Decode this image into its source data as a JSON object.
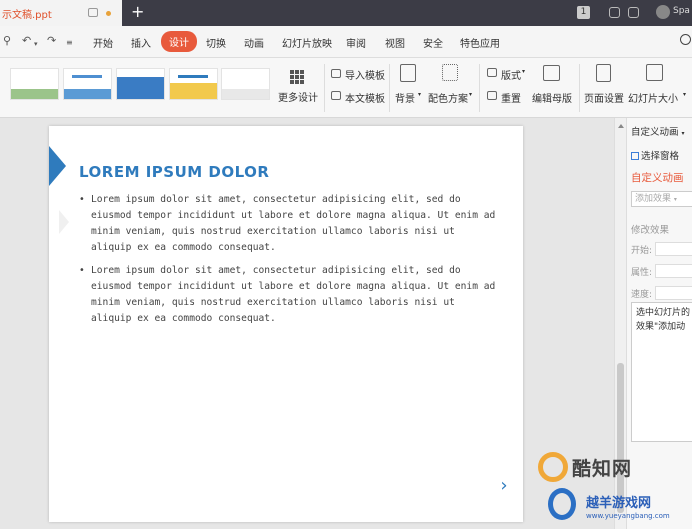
{
  "titlebar": {
    "doc_name": "示文稿.ppt",
    "user": "Spa",
    "badge": "1"
  },
  "menubar": {
    "tabs": [
      "开始",
      "插入",
      "设计",
      "切换",
      "动画",
      "幻灯片放映",
      "审阅",
      "视图",
      "安全",
      "特色应用"
    ],
    "active_tab": "设计"
  },
  "ribbon": {
    "more_designs": "更多设计",
    "import_template": "导入模板",
    "this_doc_template": "本文模板",
    "background": "背景",
    "color_scheme": "配色方案",
    "layout": "版式",
    "reset": "重置",
    "edit_master": "编辑母版",
    "page_setup": "页面设置",
    "slide_size": "幻灯片大小",
    "dropdown_caret": "▾"
  },
  "slide": {
    "title": "LOREM IPSUM DOLOR",
    "bullets": [
      "Lorem ipsum dolor sit amet, consectetur adipisicing elit, sed do eiusmod tempor incididunt ut labore et dolore magna aliqua. Ut enim ad minim veniam, quis nostrud exercitation ullamco laboris nisi ut aliquip ex ea commodo consequat.",
      "Lorem ipsum dolor sit amet, consectetur adipisicing elit, sed do eiusmod tempor incididunt ut labore et dolore magna aliqua. Ut enim ad minim veniam, quis nostrud exercitation ullamco laboris nisi ut aliquip ex ea commodo consequat."
    ],
    "accent_color": "#2f7bbd"
  },
  "pane": {
    "header": "自定义动画",
    "select_pane": "选择窗格",
    "title": "自定义动画",
    "add_effect": "添加效果",
    "modify_effect": "修改效果",
    "start_label": "开始:",
    "property_label": "属性:",
    "speed_label": "速度:",
    "hint_line1": "选中幻灯片的",
    "hint_line2": "效果\"添加动"
  },
  "watermarks": {
    "brand1": "酷知网",
    "brand2": "越羊游戏网",
    "url": "www.yueyangbang.com"
  },
  "colors": {
    "accent": "#e85a3c",
    "titlebar": "#3c3c46"
  }
}
